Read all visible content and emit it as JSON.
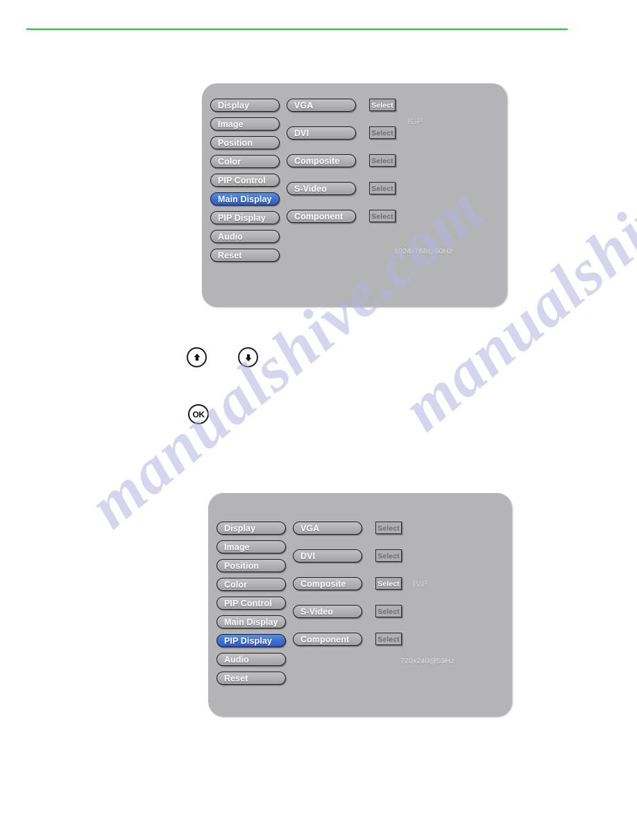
{
  "page": {
    "background_color": "#ffffff",
    "rule_color": "#22cc22",
    "watermark_text": "manualshive.com",
    "panel_color": "#b4b4b6",
    "accent_color": "#3a6fd0"
  },
  "panels": [
    {
      "id": "main-display",
      "menu_items": [
        {
          "label": "Display",
          "selected": false
        },
        {
          "label": "Image",
          "selected": false
        },
        {
          "label": "Position",
          "selected": false
        },
        {
          "label": "Color",
          "selected": false
        },
        {
          "label": "PIP Control",
          "selected": false
        },
        {
          "label": "Main Display",
          "selected": true
        },
        {
          "label": "PIP Display",
          "selected": false
        },
        {
          "label": "Audio",
          "selected": false
        },
        {
          "label": "Reset",
          "selected": false
        }
      ],
      "sources": [
        {
          "label": "VGA",
          "select_label": "Select",
          "active": true
        },
        {
          "label": "DVI",
          "select_label": "Select",
          "active": false
        },
        {
          "label": "Composite",
          "select_label": "Select",
          "active": false
        },
        {
          "label": "S-Video",
          "select_label": "Select",
          "active": false
        },
        {
          "label": "Component",
          "select_label": "Select",
          "active": false
        }
      ],
      "source_tag": "IGP",
      "resolution": "1024x768@60Hz"
    },
    {
      "id": "pip-display",
      "menu_items": [
        {
          "label": "Display",
          "selected": false
        },
        {
          "label": "Image",
          "selected": false
        },
        {
          "label": "Position",
          "selected": false
        },
        {
          "label": "Color",
          "selected": false
        },
        {
          "label": "PIP Control",
          "selected": false
        },
        {
          "label": "Main Display",
          "selected": false
        },
        {
          "label": "PIP Display",
          "selected": true
        },
        {
          "label": "Audio",
          "selected": false
        },
        {
          "label": "Reset",
          "selected": false
        }
      ],
      "sources": [
        {
          "label": "VGA",
          "select_label": "Select",
          "active": false
        },
        {
          "label": "DVI",
          "select_label": "Select",
          "active": false
        },
        {
          "label": "Composite",
          "select_label": "Select",
          "active": true
        },
        {
          "label": "S-Video",
          "select_label": "Select",
          "active": false
        },
        {
          "label": "Component",
          "select_label": "Select",
          "active": false
        }
      ],
      "source_tag": "IVP",
      "resolution": "720x240@59Hz"
    }
  ],
  "remote_keys": [
    {
      "id": "up",
      "icon": "arrow-up-icon",
      "label": ""
    },
    {
      "id": "down",
      "icon": "arrow-down-icon",
      "label": ""
    },
    {
      "id": "ok",
      "icon": "ok-icon",
      "label": "OK"
    }
  ]
}
